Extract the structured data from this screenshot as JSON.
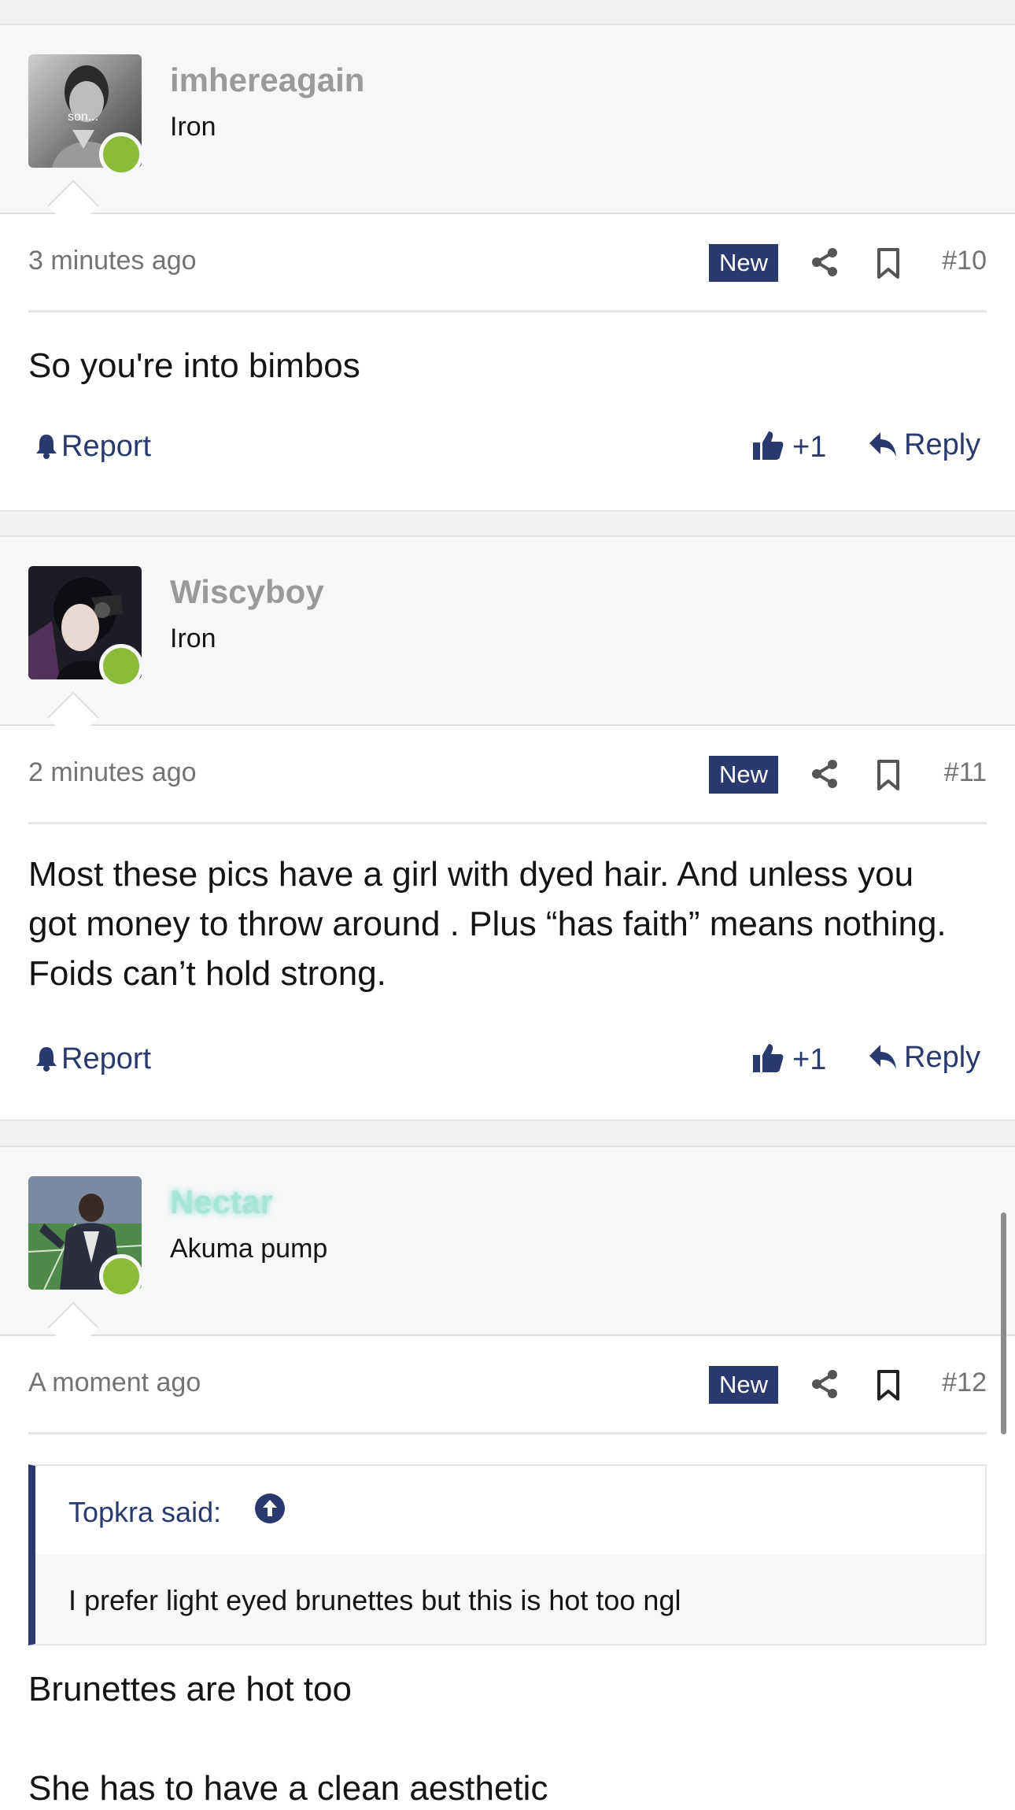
{
  "colors": {
    "accent": "#2b3a6e",
    "online": "#8cbb3a",
    "username_gray": "#9a9a9a",
    "nectar_glow": "#a7e6d6"
  },
  "posts": [
    {
      "username": "imhereagain",
      "user_title": "Iron",
      "avatar_caption": "son...",
      "time": "3 minutes ago",
      "badge": "New",
      "number": "#10",
      "body": [
        "So you're into bimbos"
      ],
      "report": "Report",
      "likes": "+1",
      "reply": "Reply"
    },
    {
      "username": "Wiscyboy",
      "user_title": "Iron",
      "time": "2 minutes ago",
      "badge": "New",
      "number": "#11",
      "body": [
        "Most these pics have a girl with dyed hair. And unless you",
        "got money to throw around . Plus “has faith” means nothing.",
        "Foids can’t hold strong."
      ],
      "report": "Report",
      "likes": "+1",
      "reply": "Reply"
    },
    {
      "username": "Nectar",
      "user_title": "Akuma pump",
      "time": "A moment ago",
      "badge": "New",
      "number": "#12",
      "quote": {
        "author": "Topkra said:",
        "text": "I prefer light eyed brunettes but this is hot too ngl"
      },
      "body": [
        "Brunettes are hot too",
        "She has to have a clean aesthetic"
      ]
    }
  ]
}
